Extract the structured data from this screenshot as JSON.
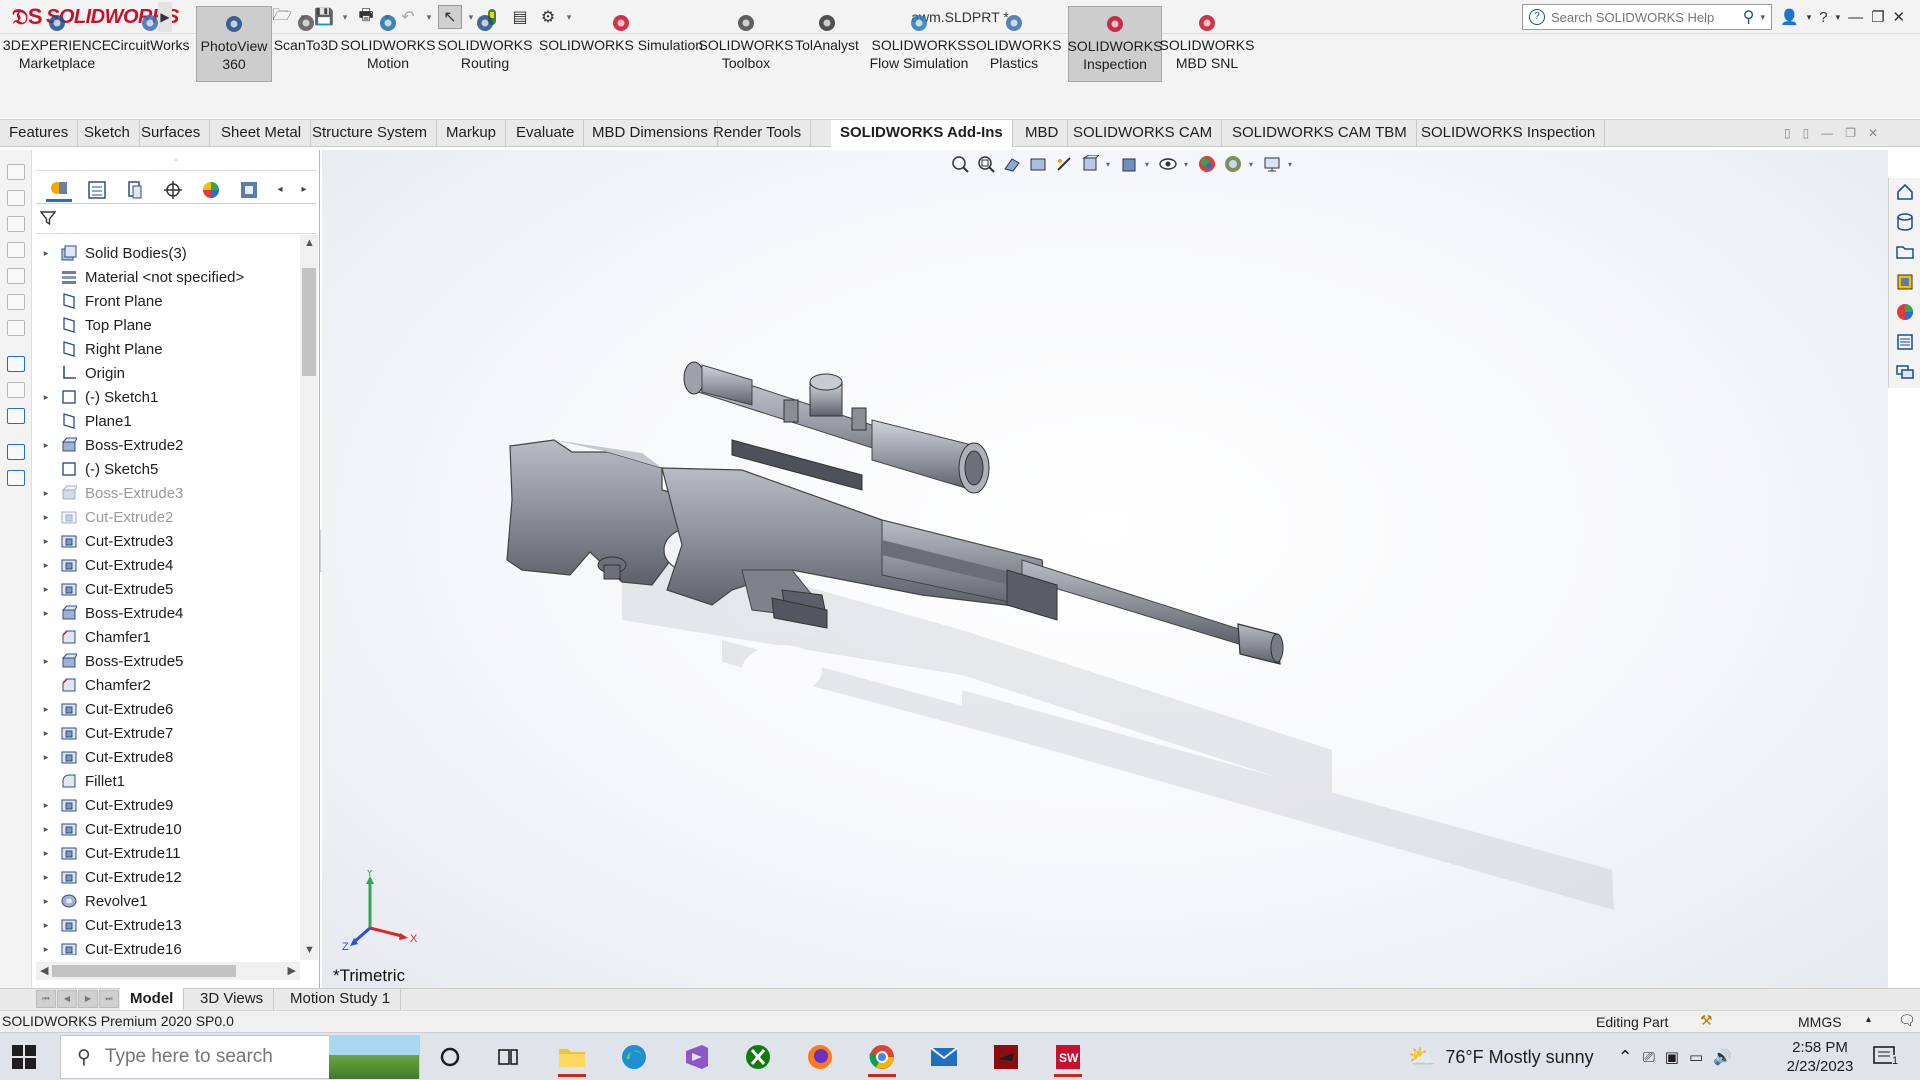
{
  "titlebar": {
    "brand": "SOLIDWORKS",
    "doc_title": "awm.SLDPRT *",
    "search_placeholder": "Search SOLIDWORKS Help"
  },
  "commands": [
    {
      "label1": "3DEXPERIENCE",
      "label2": "Marketplace",
      "icon": "3dexperience-marketplace-icon"
    },
    {
      "label1": "CircuitWorks",
      "label2": "",
      "icon": "circuitworks-icon"
    },
    {
      "label1": "PhotoView",
      "label2": "360",
      "icon": "photoview-360-icon",
      "active": true
    },
    {
      "label1": "ScanTo3D",
      "label2": "",
      "icon": "scanto3d-icon"
    },
    {
      "label1": "SOLIDWORKS",
      "label2": "Motion",
      "icon": "motion-icon"
    },
    {
      "label1": "SOLIDWORKS",
      "label2": "Routing",
      "icon": "routing-icon"
    },
    {
      "label1": "SOLIDWORKS Simulation",
      "label2": "",
      "icon": "simulation-icon"
    },
    {
      "label1": "SOLIDWORKS",
      "label2": "Toolbox",
      "icon": "toolbox-icon"
    },
    {
      "label1": "TolAnalyst",
      "label2": "",
      "icon": "tolanalyst-icon"
    },
    {
      "label1": "SOLIDWORKS",
      "label2": "Flow Simulation",
      "icon": "flow-simulation-icon"
    },
    {
      "label1": "SOLIDWORKS",
      "label2": "Plastics",
      "icon": "plastics-icon"
    },
    {
      "label1": "SOLIDWORKS",
      "label2": "Inspection",
      "icon": "inspection-icon",
      "active": true
    },
    {
      "label1": "SOLIDWORKS",
      "label2": "MBD SNL",
      "icon": "mbd-snl-icon"
    }
  ],
  "tabs": [
    "Features",
    "Sketch",
    "Surfaces",
    "Sheet Metal",
    "Structure System",
    "Markup",
    "Evaluate",
    "MBD Dimensions",
    "Render Tools",
    "SOLIDWORKS Add-Ins",
    "MBD",
    "SOLIDWORKS CAM",
    "SOLIDWORKS CAM TBM",
    "SOLIDWORKS Inspection"
  ],
  "active_tab": "SOLIDWORKS Add-Ins",
  "tree": [
    {
      "label": "Solid Bodies(3)",
      "icon": "solid-bodies-icon",
      "expand": true
    },
    {
      "label": "Material <not specified>",
      "icon": "material-icon",
      "expand": false
    },
    {
      "label": "Front Plane",
      "icon": "plane-icon",
      "expand": false
    },
    {
      "label": "Top Plane",
      "icon": "plane-icon",
      "expand": false
    },
    {
      "label": "Right Plane",
      "icon": "plane-icon",
      "expand": false
    },
    {
      "label": "Origin",
      "icon": "origin-icon",
      "expand": false
    },
    {
      "label": "(-) Sketch1",
      "icon": "sketch-icon",
      "expand": true
    },
    {
      "label": "Plane1",
      "icon": "plane-icon",
      "expand": false
    },
    {
      "label": "Boss-Extrude2",
      "icon": "boss-extrude-icon",
      "expand": true
    },
    {
      "label": "(-) Sketch5",
      "icon": "sketch-icon",
      "expand": false
    },
    {
      "label": "Boss-Extrude3",
      "icon": "boss-extrude-icon",
      "expand": true,
      "suppressed": true
    },
    {
      "label": "Cut-Extrude2",
      "icon": "cut-extrude-icon",
      "expand": true,
      "suppressed": true
    },
    {
      "label": "Cut-Extrude3",
      "icon": "cut-extrude-icon",
      "expand": true
    },
    {
      "label": "Cut-Extrude4",
      "icon": "cut-extrude-icon",
      "expand": true
    },
    {
      "label": "Cut-Extrude5",
      "icon": "cut-extrude-icon",
      "expand": true
    },
    {
      "label": "Boss-Extrude4",
      "icon": "boss-extrude-icon",
      "expand": true
    },
    {
      "label": "Chamfer1",
      "icon": "chamfer-icon",
      "expand": false
    },
    {
      "label": "Boss-Extrude5",
      "icon": "boss-extrude-icon",
      "expand": true
    },
    {
      "label": "Chamfer2",
      "icon": "chamfer-icon",
      "expand": false
    },
    {
      "label": "Cut-Extrude6",
      "icon": "cut-extrude-icon",
      "expand": true
    },
    {
      "label": "Cut-Extrude7",
      "icon": "cut-extrude-icon",
      "expand": true
    },
    {
      "label": "Cut-Extrude8",
      "icon": "cut-extrude-icon",
      "expand": true
    },
    {
      "label": "Fillet1",
      "icon": "fillet-icon",
      "expand": false
    },
    {
      "label": "Cut-Extrude9",
      "icon": "cut-extrude-icon",
      "expand": true
    },
    {
      "label": "Cut-Extrude10",
      "icon": "cut-extrude-icon",
      "expand": true
    },
    {
      "label": "Cut-Extrude11",
      "icon": "cut-extrude-icon",
      "expand": true
    },
    {
      "label": "Cut-Extrude12",
      "icon": "cut-extrude-icon",
      "expand": true
    },
    {
      "label": "Revolve1",
      "icon": "revolve-icon",
      "expand": true
    },
    {
      "label": "Cut-Extrude13",
      "icon": "cut-extrude-icon",
      "expand": true
    },
    {
      "label": "Cut-Extrude16",
      "icon": "cut-extrude-icon",
      "expand": true
    }
  ],
  "viewport": {
    "view_name": "*Trimetric",
    "triad": {
      "y": "Y",
      "x": "X",
      "z": "Z"
    }
  },
  "bottom_tabs": [
    "Model",
    "3D Views",
    "Motion Study 1"
  ],
  "active_bottom_tab": "Model",
  "status": {
    "version": "SOLIDWORKS Premium 2020 SP0.0",
    "mode": "Editing Part",
    "units": "MMGS"
  },
  "taskbar": {
    "search_placeholder": "Type here to search",
    "weather": "76°F  Mostly sunny",
    "time": "2:58 PM",
    "date": "2/23/2023",
    "notifications": "1"
  }
}
